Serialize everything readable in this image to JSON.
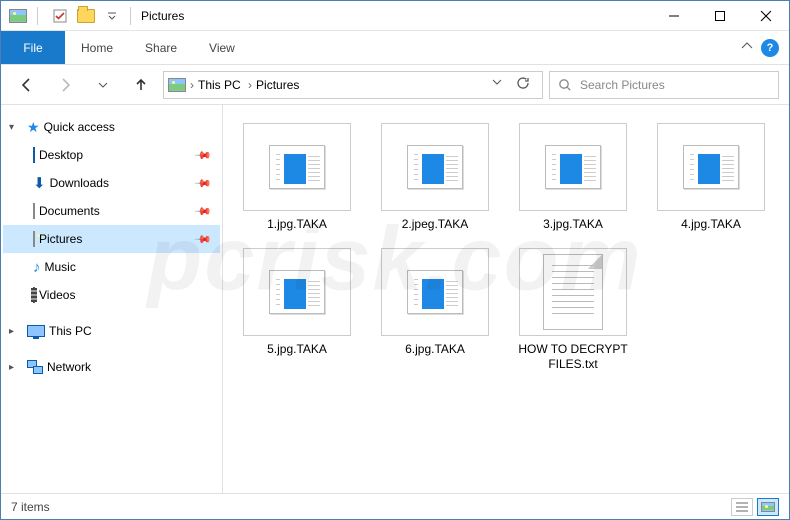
{
  "titlebar": {
    "title": "Pictures"
  },
  "ribbon": {
    "file": "File",
    "tabs": [
      "Home",
      "Share",
      "View"
    ]
  },
  "breadcrumbs": [
    "This PC",
    "Pictures"
  ],
  "search": {
    "placeholder": "Search Pictures"
  },
  "nav": {
    "quick": {
      "label": "Quick access",
      "items": [
        {
          "label": "Desktop",
          "icon": "desktop",
          "pinned": true
        },
        {
          "label": "Downloads",
          "icon": "downloads",
          "pinned": true
        },
        {
          "label": "Documents",
          "icon": "documents",
          "pinned": true
        },
        {
          "label": "Pictures",
          "icon": "pictures",
          "pinned": true,
          "selected": true
        },
        {
          "label": "Music",
          "icon": "music",
          "pinned": false
        },
        {
          "label": "Videos",
          "icon": "videos",
          "pinned": false
        }
      ]
    },
    "thispc": "This PC",
    "network": "Network"
  },
  "files": [
    {
      "name": "1.jpg.TAKA",
      "kind": "taka"
    },
    {
      "name": "2.jpeg.TAKA",
      "kind": "taka"
    },
    {
      "name": "3.jpg.TAKA",
      "kind": "taka"
    },
    {
      "name": "4.jpg.TAKA",
      "kind": "taka"
    },
    {
      "name": "5.jpg.TAKA",
      "kind": "taka"
    },
    {
      "name": "6.jpg.TAKA",
      "kind": "taka"
    },
    {
      "name": "HOW TO DECRYPT FILES.txt",
      "kind": "txt"
    }
  ],
  "status": {
    "count": "7 items"
  },
  "watermark": "pcrisk.com"
}
